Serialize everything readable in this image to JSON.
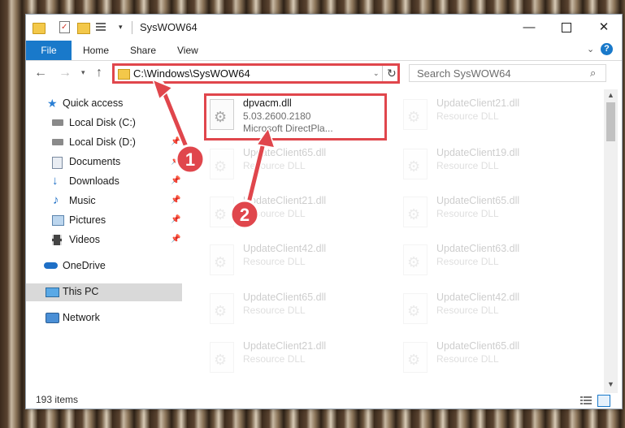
{
  "window": {
    "title": "SysWOW64"
  },
  "window_controls": {
    "minimize": "—",
    "maximize": "",
    "close": "✕"
  },
  "ribbon": {
    "tabs": [
      {
        "label": "File"
      },
      {
        "label": "Home"
      },
      {
        "label": "Share"
      },
      {
        "label": "View"
      }
    ],
    "collapse_icon": "chevron-down-icon",
    "help": "?"
  },
  "address_bar": {
    "path": "C:\\Windows\\SysWOW64"
  },
  "search": {
    "placeholder": "Search SysWOW64"
  },
  "sidebar": {
    "items": [
      {
        "label": "Quick access",
        "icon": "star-icon"
      },
      {
        "label": "Local Disk (C:)",
        "icon": "drive-icon"
      },
      {
        "label": "Local Disk (D:)",
        "icon": "drive-icon"
      },
      {
        "label": "Documents",
        "icon": "documents-icon"
      },
      {
        "label": "Downloads",
        "icon": "download-arrow-icon"
      },
      {
        "label": "Music",
        "icon": "music-note-icon"
      },
      {
        "label": "Pictures",
        "icon": "pictures-icon"
      },
      {
        "label": "Videos",
        "icon": "film-icon"
      },
      {
        "label": "OneDrive",
        "icon": "cloud-icon"
      },
      {
        "label": "This PC",
        "icon": "monitor-icon"
      },
      {
        "label": "Network",
        "icon": "network-icon"
      }
    ]
  },
  "files": [
    {
      "name": "dpvacm.dll",
      "version": "5.03.2600.2180",
      "description": "Microsoft DirectPla..."
    },
    {
      "name": "UpdateClient21.dll",
      "description": "Resource DLL"
    },
    {
      "name": "UpdateClient65.dll",
      "description": "Resource DLL"
    },
    {
      "name": "UpdateClient19.dll",
      "description": "Resource DLL"
    },
    {
      "name": "UpdateClient21.dll",
      "description": "Resource DLL"
    },
    {
      "name": "UpdateClient65.dll",
      "description": "Resource DLL"
    },
    {
      "name": "UpdateClient42.dll",
      "description": "Resource DLL"
    },
    {
      "name": "UpdateClient63.dll",
      "description": "Resource DLL"
    },
    {
      "name": "UpdateClient65.dll",
      "description": "Resource DLL"
    },
    {
      "name": "UpdateClient42.dll",
      "description": "Resource DLL"
    },
    {
      "name": "UpdateClient21.dll",
      "description": "Resource DLL"
    },
    {
      "name": "UpdateClient65.dll",
      "description": "Resource DLL"
    }
  ],
  "status_bar": {
    "item_count": "193 items"
  },
  "annotations": {
    "badge1": "1",
    "badge2": "2",
    "color": "#e0464c"
  }
}
